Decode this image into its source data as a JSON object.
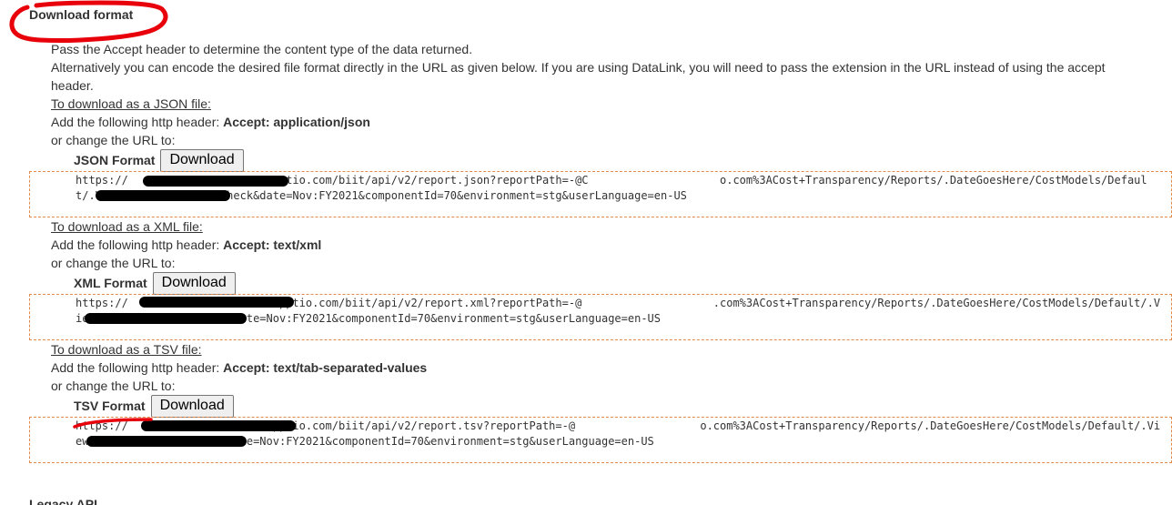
{
  "section": {
    "title": "Download format",
    "intro_line1": "Pass the Accept header to determine the content type of the data returned.",
    "intro_line2": "Alternatively you can encode the desired file format directly in the URL as given below. If you are using DataLink, you will need to pass the extension in the URL instead of using the accept header."
  },
  "formats": [
    {
      "link_text": "To download as a JSON file:",
      "header_prefix": "Add the following http header: ",
      "header_value": "Accept: application/json",
      "change_url_text": "or change the URL to:",
      "label": "JSON Format",
      "button_label": "Download",
      "url": "https://                    .apptio.com/biit/api/v2/report.json?reportPath=-@C                    o.com%3ACost+Transparency/Reports/.DateGoesHere/CostModels/Default/.View%3ACost+Source+Check&date=Nov:FY2021&componentId=70&environment=stg&userLanguage=en-US"
    },
    {
      "link_text": "To download as a XML file:",
      "header_prefix": "Add the following http header: ",
      "header_value": "Accept: text/xml",
      "change_url_text": "or change the URL to:",
      "label": "XML Format",
      "button_label": "Download",
      "url": "https://                    o.apptio.com/biit/api/v2/report.xml?reportPath=-@                    .com%3ACost+Transparency/Reports/.DateGoesHere/CostModels/Default/.View%3ACost+Source+Check&date=Nov:FY2021&componentId=70&environment=stg&userLanguage=en-US"
    },
    {
      "link_text": "To download as a TSV file:",
      "header_prefix": "Add the following http header: ",
      "header_value": "Accept: text/tab-separated-values",
      "change_url_text": "or change the URL to:",
      "label": "TSV Format",
      "button_label": "Download",
      "url": "https://                    .apptio.com/biit/api/v2/report.tsv?reportPath=-@                   o.com%3ACost+Transparency/Reports/.DateGoesHere/CostModels/Default/.View%3ACost+Source+Check&date=Nov:FY2021&componentId=70&environment=stg&userLanguage=en-US"
    }
  ],
  "legacy": {
    "title": "Legacy API"
  },
  "colors": {
    "annotation_red": "#e8000b",
    "box_border": "#e38a4a",
    "text": "#333333"
  }
}
